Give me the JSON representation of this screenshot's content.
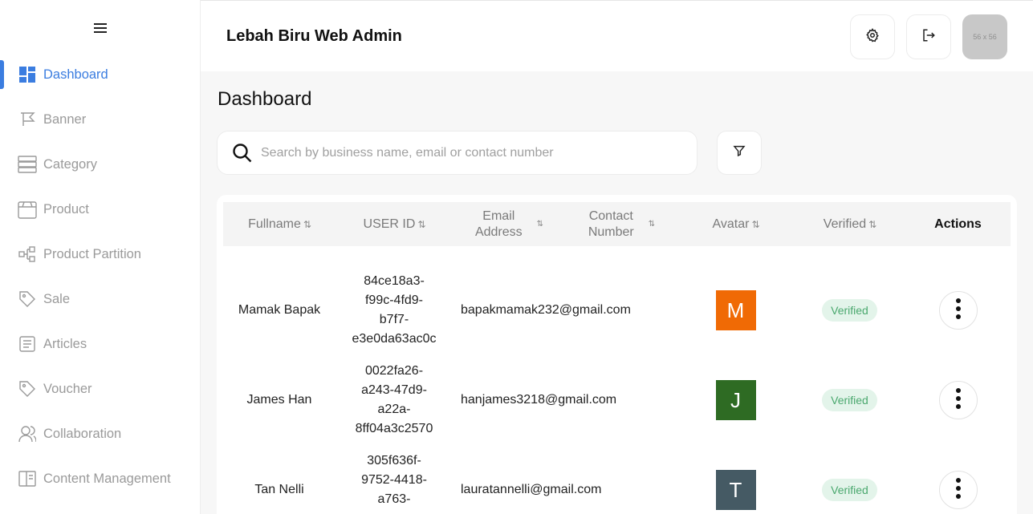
{
  "header": {
    "app_title": "Lebah Biru Web Admin",
    "avatar_placeholder": "56 x 56",
    "settings_icon": "gear-icon",
    "logout_icon": "logout-icon"
  },
  "sidebar": {
    "items": [
      {
        "label": "Dashboard",
        "icon": "dashboard-icon",
        "active": true
      },
      {
        "label": "Banner",
        "icon": "flag-icon"
      },
      {
        "label": "Category",
        "icon": "category-icon"
      },
      {
        "label": "Product",
        "icon": "box-icon"
      },
      {
        "label": "Product Partition",
        "icon": "partition-icon"
      },
      {
        "label": "Sale",
        "icon": "tag-icon"
      },
      {
        "label": "Articles",
        "icon": "article-icon"
      },
      {
        "label": "Voucher",
        "icon": "tag-icon"
      },
      {
        "label": "Collaboration",
        "icon": "users-icon"
      },
      {
        "label": "Content Management",
        "icon": "content-icon"
      }
    ]
  },
  "main": {
    "page_title": "Dashboard",
    "search": {
      "placeholder": "Search by business name, email or contact number",
      "value": ""
    },
    "table": {
      "headers": {
        "fullname": "Fullname",
        "user_id": "USER ID",
        "email_1": "Email",
        "email_2": "Address",
        "contact_1": "Contact",
        "contact_2": "Number",
        "avatar": "Avatar",
        "verified": "Verified",
        "actions": "Actions"
      },
      "sort_glyph": "⇅",
      "rows": [
        {
          "fullname": "Mamak Bapak",
          "user_id": [
            "84ce18a3-",
            "f99c-4fd9-",
            "b7f7-",
            "e3e0da63ac0c"
          ],
          "email": "bapakmamak232@gmail.com",
          "contact": "",
          "avatar_letter": "M",
          "avatar_color": "#f06a05",
          "verified": "Verified"
        },
        {
          "fullname": "James Han",
          "user_id": [
            "0022fa26-",
            "a243-47d9-",
            "a22a-",
            "8ff04a3c2570"
          ],
          "email": "hanjames3218@gmail.com",
          "contact": "",
          "avatar_letter": "J",
          "avatar_color": "#2e6b23",
          "verified": "Verified"
        },
        {
          "fullname": "Tan Nelli",
          "user_id": [
            "305f636f-",
            "9752-4418-",
            "a763-"
          ],
          "email": "lauratannelli@gmail.com",
          "contact": "",
          "avatar_letter": "T",
          "avatar_color": "#455a64",
          "verified": "Verified"
        }
      ]
    }
  },
  "colors": {
    "accent": "#3b7de0",
    "verified_bg": "#e3f4ea",
    "verified_text": "#4aa86e"
  }
}
